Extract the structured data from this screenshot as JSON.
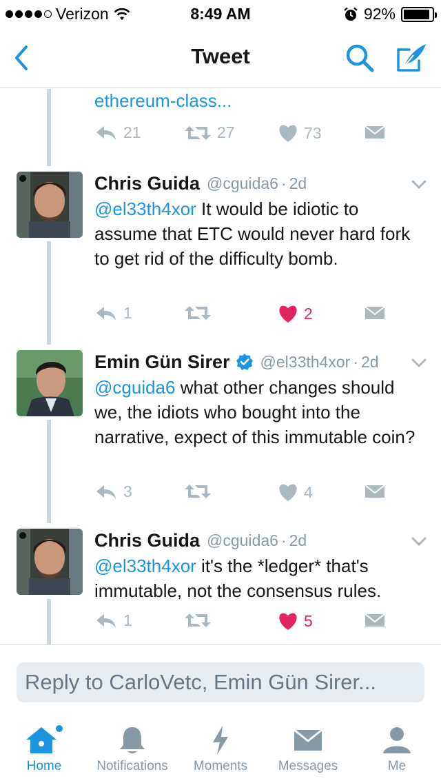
{
  "status": {
    "carrier": "Verizon",
    "time": "8:49 AM",
    "battery": "92%",
    "battery_level": 0.92
  },
  "nav": {
    "title": "Tweet",
    "back_icon": "chevron-left-icon",
    "search_icon": "search-icon",
    "compose_icon": "compose-icon"
  },
  "feed": {
    "partial_link": "ethereum-class...",
    "top_actions": {
      "replies": "21",
      "retweets": "27",
      "likes": "73"
    },
    "tweets": [
      {
        "name": "Chris Guida",
        "handle": "@cguida6",
        "time": "2d",
        "mention": "@el33th4xor",
        "text": " It would be idiotic to assume that ETC would never hard fork to get rid of the difficulty bomb.",
        "replies": "1",
        "retweets": "",
        "likes": "2",
        "liked": true
      },
      {
        "name": "Emin Gün Sirer",
        "handle": "@el33th4xor",
        "time": "2d",
        "verified": true,
        "mention": "@cguida6",
        "text": " what other changes should we, the idiots who bought into the narrative, expect of this immutable coin?",
        "replies": "3",
        "retweets": "",
        "likes": "4",
        "liked": false
      },
      {
        "name": "Chris Guida",
        "handle": "@cguida6",
        "time": "2d",
        "mention": "@el33th4xor",
        "text": " it's the *ledger* that's immutable, not the consensus rules.",
        "replies": "1",
        "retweets": "",
        "likes": "5",
        "liked": true
      }
    ]
  },
  "reply": {
    "placeholder": "Reply to CarloVetc, Emin Gün Sirer..."
  },
  "tabs": [
    {
      "label": "Home",
      "icon": "home-icon",
      "active": true
    },
    {
      "label": "Notifications",
      "icon": "bell-icon",
      "active": false
    },
    {
      "label": "Moments",
      "icon": "lightning-icon",
      "active": false
    },
    {
      "label": "Messages",
      "icon": "envelope-icon",
      "active": false
    },
    {
      "label": "Me",
      "icon": "person-icon",
      "active": false
    }
  ],
  "colors": {
    "accent": "#1b95e0",
    "like": "#e0245e",
    "muted": "#aab8c2"
  }
}
